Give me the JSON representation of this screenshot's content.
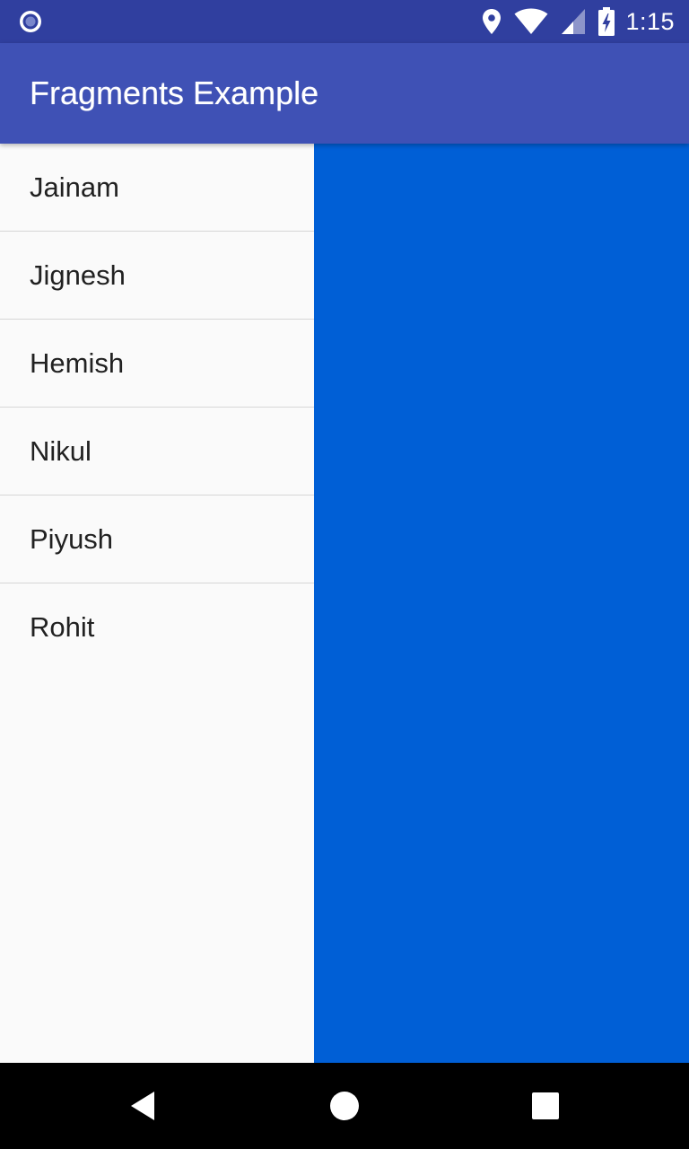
{
  "status_bar": {
    "time": "1:15",
    "icons": [
      "notification-circle-icon",
      "location-pin-icon",
      "wifi-icon",
      "cell-signal-icon",
      "battery-charging-icon"
    ]
  },
  "app_bar": {
    "title": "Fragments Example"
  },
  "list": {
    "items": [
      {
        "label": "Jainam"
      },
      {
        "label": "Jignesh"
      },
      {
        "label": "Hemish"
      },
      {
        "label": "Nikul"
      },
      {
        "label": "Piyush"
      },
      {
        "label": "Rohit"
      }
    ]
  },
  "detail_panel": {
    "color": "#005fd6"
  },
  "nav_bar": {
    "buttons": [
      "back-icon",
      "home-icon",
      "recents-icon"
    ]
  },
  "colors": {
    "status_bar": "#303f9f",
    "app_bar": "#3f51b5",
    "detail_panel": "#005fd6",
    "list_background": "#fafafa",
    "nav_bar": "#000000"
  }
}
